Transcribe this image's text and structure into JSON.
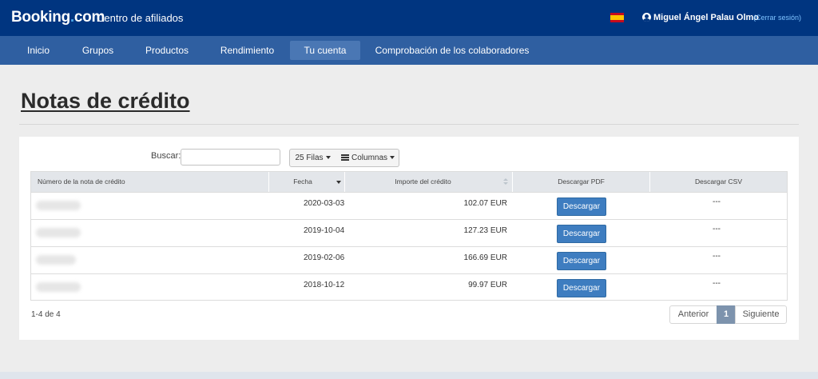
{
  "header": {
    "logo_main": "Booking",
    "logo_dot": ".",
    "logo_tail": "com",
    "portal_name": "Centro de afiliados",
    "language_flag_icon": "spain-flag-icon",
    "user_icon": "user-circle-icon",
    "user_name": "Miguel Ángel Palau Olmo",
    "logout_label": "(Cerrar sesión)"
  },
  "nav": {
    "items": [
      {
        "label": "Inicio",
        "active": false
      },
      {
        "label": "Grupos",
        "active": false
      },
      {
        "label": "Productos",
        "active": false
      },
      {
        "label": "Rendimiento",
        "active": false
      },
      {
        "label": "Tu cuenta",
        "active": true
      },
      {
        "label": "Comprobación de los colaboradores",
        "active": false
      }
    ]
  },
  "page": {
    "title": "Notas de crédito"
  },
  "toolbar": {
    "search_label": "Buscar:",
    "search_value": "",
    "rows_label": "25 Filas",
    "columns_label": "Columnas"
  },
  "table": {
    "columns": [
      {
        "label": "Número de la nota de crédito"
      },
      {
        "label": "Fecha",
        "sort": "descending"
      },
      {
        "label": "Importe del crédito",
        "sort": "sortable"
      },
      {
        "label": "Descargar PDF"
      },
      {
        "label": "Descargar CSV"
      }
    ],
    "rows": [
      {
        "number": "",
        "date": "2020-03-03",
        "amount": "102.07 EUR",
        "pdf_label": "Descargar",
        "csv": "---"
      },
      {
        "number": "",
        "date": "2019-10-04",
        "amount": "127.23 EUR",
        "pdf_label": "Descargar",
        "csv": "---"
      },
      {
        "number": "",
        "date": "2019-02-06",
        "amount": "166.69 EUR",
        "pdf_label": "Descargar",
        "csv": "---"
      },
      {
        "number": "",
        "date": "2018-10-12",
        "amount": "99.97 EUR",
        "pdf_label": "Descargar",
        "csv": "---"
      }
    ]
  },
  "pagination": {
    "range_text": "1-4 de 4",
    "previous_label": "Anterior",
    "current_page": "1",
    "next_label": "Siguiente"
  },
  "colors": {
    "header_bg": "#003580",
    "nav_bg": "#2f5fa1",
    "nav_active_bg": "#4a77b4",
    "button_bg": "#3e7dc0",
    "link": "#7ec3ff"
  }
}
